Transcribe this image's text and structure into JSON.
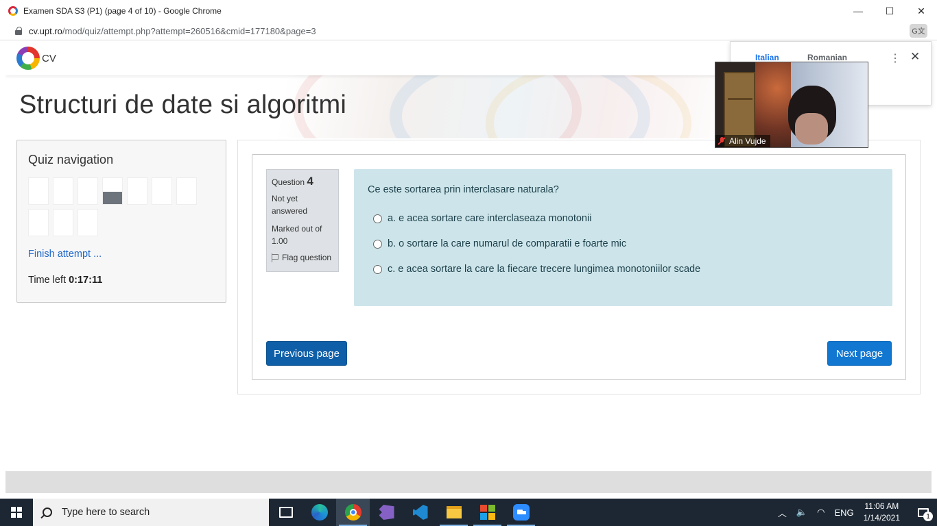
{
  "window": {
    "title": "Examen SDA S3 (P1) (page 4 of 10) - Google Chrome",
    "minimize": "—",
    "maximize": "☐",
    "close": "✕"
  },
  "address": {
    "host": "cv.upt.ro",
    "path": "/mod/quiz/attempt.php?attempt=260516&cmid=177180&page=3"
  },
  "site": {
    "logo_text": "CV",
    "course_title": "Structuri de date si algoritmi"
  },
  "quiz_nav": {
    "title": "Quiz navigation",
    "current_question": 4,
    "question_count": 10,
    "finish_link": "Finish attempt ...",
    "time_label": "Time left",
    "time_value": "0:17:11"
  },
  "question": {
    "label": "Question",
    "number": "4",
    "state": "Not yet answered",
    "grade": "Marked out of 1.00",
    "flag": "Flag question",
    "text": "Ce este sortarea prin interclasare naturala?",
    "answers": [
      "a. e acea sortare care interclaseaza monotonii",
      "b. o sortare la care numarul de comparatii e foarte mic",
      "c. e acea sortare la care la fiecare trecere lungimea monotoniilor scade"
    ]
  },
  "buttons": {
    "previous": "Previous page",
    "next": "Next page"
  },
  "translate_popup": {
    "active_language": "Italian",
    "other_language": "Romanian",
    "more": "⋮",
    "close": "✕"
  },
  "video": {
    "participant_name": "Alin Vujde"
  },
  "taskbar": {
    "search_placeholder": "Type here to search",
    "language": "ENG",
    "time": "11:06 AM",
    "date": "1/14/2021",
    "notification_count": "1"
  }
}
